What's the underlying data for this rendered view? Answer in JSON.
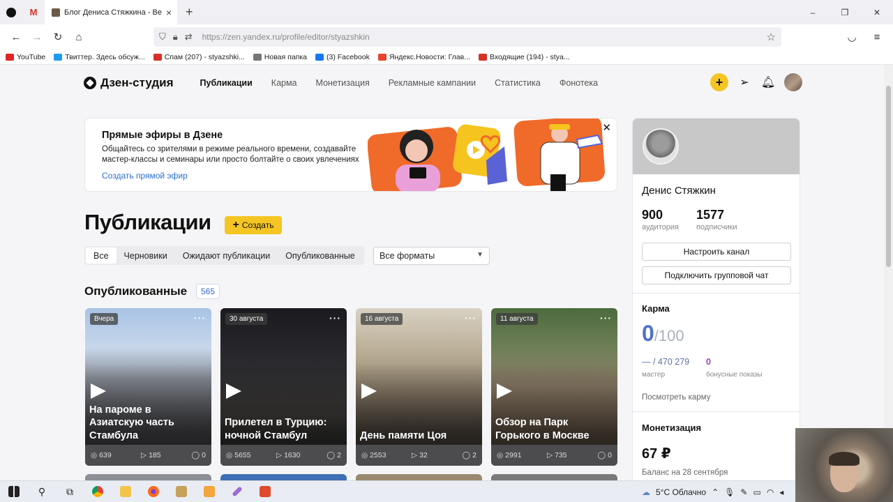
{
  "browser": {
    "tab_title": "Блог Дениса Стяжкина - Вести",
    "tab_close": "×",
    "new_tab": "+",
    "url": "https://zen.yandex.ru/profile/editor/styazshkin",
    "window_controls": [
      "–",
      "❐",
      "✕"
    ]
  },
  "bookmarks": [
    {
      "label": "YouTube",
      "color": "#e02424"
    },
    {
      "label": "Твиттер. Здесь обсуж...",
      "color": "#1d9bf0"
    },
    {
      "label": "Спам (207) - styazshki...",
      "color": "#d93025"
    },
    {
      "label": "Новая папка",
      "color": "#777777"
    },
    {
      "label": "(3) Facebook",
      "color": "#1877f2"
    },
    {
      "label": "Яндекс.Новости: Глав...",
      "color": "#e8442f"
    },
    {
      "label": "Входящие (194) - stya...",
      "color": "#d93025"
    }
  ],
  "header": {
    "logo": "Дзен-студия",
    "nav": [
      "Публикации",
      "Карма",
      "Монетизация",
      "Рекламные кампании",
      "Статистика",
      "Фонотека"
    ]
  },
  "banner": {
    "title": "Прямые эфиры в Дзене",
    "text": "Общайтесь со зрителями в режиме реального времени, создавайте мастер-классы и семинары или просто болтайте о своих увлечениях",
    "link": "Создать прямой эфир",
    "close": "✕"
  },
  "main": {
    "title": "Публикации",
    "create_label": "Создать",
    "filters": [
      "Все",
      "Черновики",
      "Ожидают публикации",
      "Опубликованные"
    ],
    "format_select": "Все форматы",
    "published_title": "Опубликованные",
    "published_count": "565",
    "cards": [
      {
        "date": "Вчера",
        "title": "На пароме в Азиатскую часть Стамбула",
        "views": "639",
        "plays": "185",
        "comments": "0"
      },
      {
        "date": "30 августа",
        "title": "Прилетел в Турцию: ночной Стамбул",
        "views": "5655",
        "plays": "1630",
        "comments": "2"
      },
      {
        "date": "16 августа",
        "title": "День памяти Цоя",
        "views": "2553",
        "plays": "32",
        "comments": "2"
      },
      {
        "date": "11 августа",
        "title": "Обзор на Парк Горького в Москве",
        "views": "2991",
        "plays": "735",
        "comments": "0"
      }
    ]
  },
  "sidebar": {
    "name": "Денис Стяжкин",
    "audience": "900",
    "audience_label": "аудитория",
    "subscribers": "1577",
    "subscribers_label": "подписчики",
    "setup_channel": "Настроить канал",
    "group_chat": "Подключить групповой чат",
    "karma_title": "Карма",
    "karma_value": "0",
    "karma_max": "/100",
    "karma_rank": "— / 470 279",
    "karma_rank_label": "мастер",
    "bonus": "0",
    "bonus_label": "бонусные показы",
    "karma_link": "Посмотреть карму",
    "monetization_title": "Монетизация",
    "balance": "67 ₽",
    "balance_label": "Баланс на 28 сентября"
  },
  "taskbar": {
    "weather": "5°C Облачно"
  }
}
